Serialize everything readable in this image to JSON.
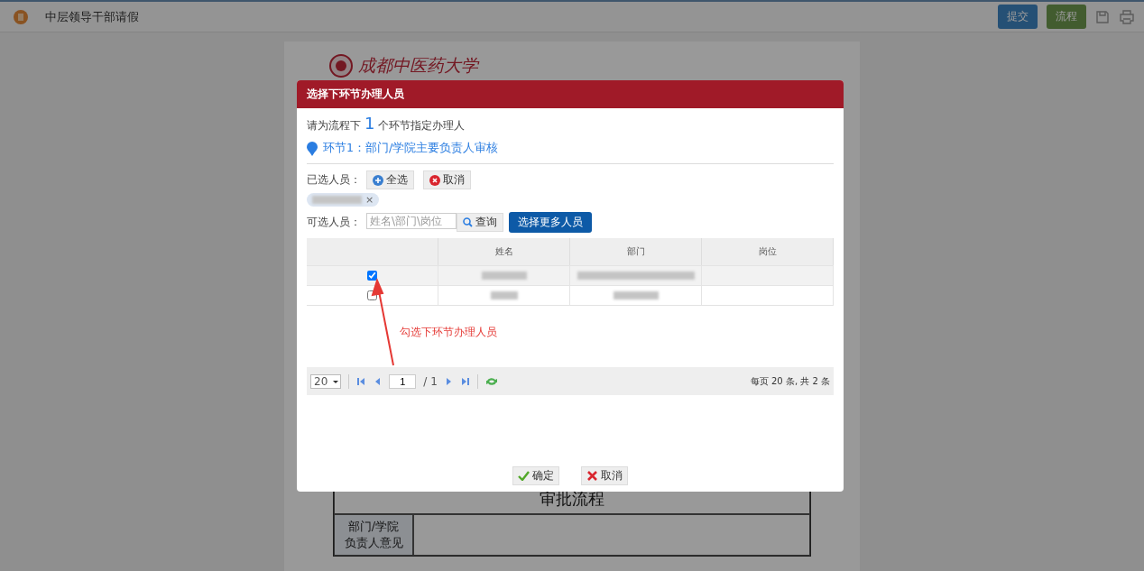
{
  "app": {
    "title": "中层领导干部请假",
    "buttons": [
      {
        "label": "提交",
        "kind": "primary"
      },
      {
        "label": "流程",
        "kind": "success"
      }
    ]
  },
  "document": {
    "logo_text": "成都中医药大学",
    "section_title": "审批流程",
    "row_label_lines": [
      "部门/学院",
      "负责人意见"
    ]
  },
  "dialog": {
    "title": "选择下环节办理人员",
    "intro_before": "请为流程下",
    "count": "1",
    "intro_after": "个环节指定办理人",
    "step": "环节1：部门/学院主要负责人审核",
    "selected_label": "已选人员：",
    "select_all": "全选",
    "clear": "取消",
    "chip_remove": "×",
    "available_label": "可选人员：",
    "search_placeholder": "姓名\\部门\\岗位",
    "search_button": "查询",
    "more_button": "选择更多人员",
    "table": {
      "columns": [
        "姓名",
        "部门",
        "岗位"
      ],
      "rows": [
        {
          "checked": true,
          "selected": true
        },
        {
          "checked": false,
          "selected": false
        }
      ]
    },
    "pager": {
      "page_size": "20",
      "page": "1",
      "total_pages": "/ 1",
      "summary": "每页 20 条, 共 2 条"
    },
    "buttons": [
      {
        "label": "确定",
        "kind": "ok"
      },
      {
        "label": "取消",
        "kind": "cancel"
      }
    ]
  },
  "annotation": {
    "text": "勾选下环节办理人员"
  }
}
